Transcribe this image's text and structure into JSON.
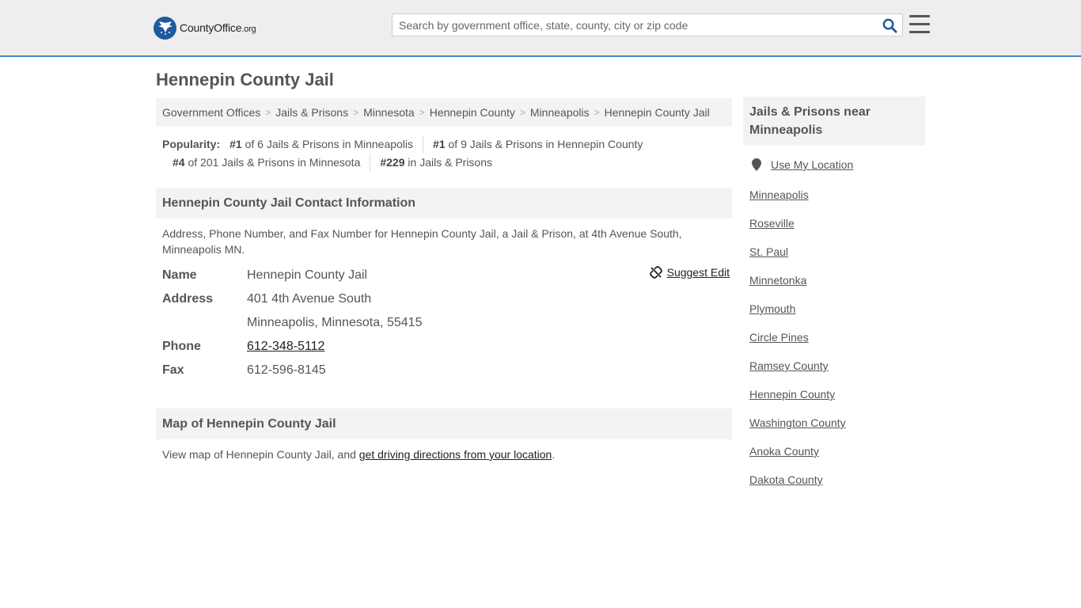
{
  "header": {
    "logo_county": "County",
    "logo_office": "Office",
    "logo_domain": ".org",
    "search_placeholder": "Search by government office, state, county, city or zip code",
    "search_icon": "search-icon",
    "menu_icon": "hamburger-icon",
    "accent_color": "#4a86c5"
  },
  "page": {
    "title": "Hennepin County Jail"
  },
  "breadcrumb": [
    "Government Offices",
    "Jails & Prisons",
    "Minnesota",
    "Hennepin County",
    "Minneapolis",
    "Hennepin County Jail"
  ],
  "popularity": {
    "label": "Popularity:",
    "items": [
      {
        "rank": "#1",
        "text": "of 6 Jails & Prisons in Minneapolis"
      },
      {
        "rank": "#1",
        "text": "of 9 Jails & Prisons in Hennepin County"
      },
      {
        "rank": "#4",
        "text": "of 201 Jails & Prisons in Minnesota"
      },
      {
        "rank": "#229",
        "text": "in Jails & Prisons"
      }
    ]
  },
  "contact": {
    "heading": "Hennepin County Jail Contact Information",
    "description": "Address, Phone Number, and Fax Number for Hennepin County Jail, a Jail & Prison, at 4th Avenue South, Minneapolis MN.",
    "suggest_edit": "Suggest Edit",
    "name_label": "Name",
    "name_value": "Hennepin County Jail",
    "address_label": "Address",
    "address_line1": "401 4th Avenue South",
    "address_line2": "Minneapolis, Minnesota, 55415",
    "phone_label": "Phone",
    "phone_value": "612-348-5112",
    "fax_label": "Fax",
    "fax_value": "612-596-8145"
  },
  "map": {
    "heading": "Map of Hennepin County Jail",
    "desc_prefix": "View map of Hennepin County Jail, and ",
    "desc_link": "get driving directions from your location",
    "desc_suffix": "."
  },
  "sidebar": {
    "heading": "Jails & Prisons near Minneapolis",
    "use_location": "Use My Location",
    "items": [
      "Minneapolis",
      "Roseville",
      "St. Paul",
      "Minnetonka",
      "Plymouth",
      "Circle Pines",
      "Ramsey County",
      "Hennepin County",
      "Washington County",
      "Anoka County",
      "Dakota County"
    ]
  }
}
